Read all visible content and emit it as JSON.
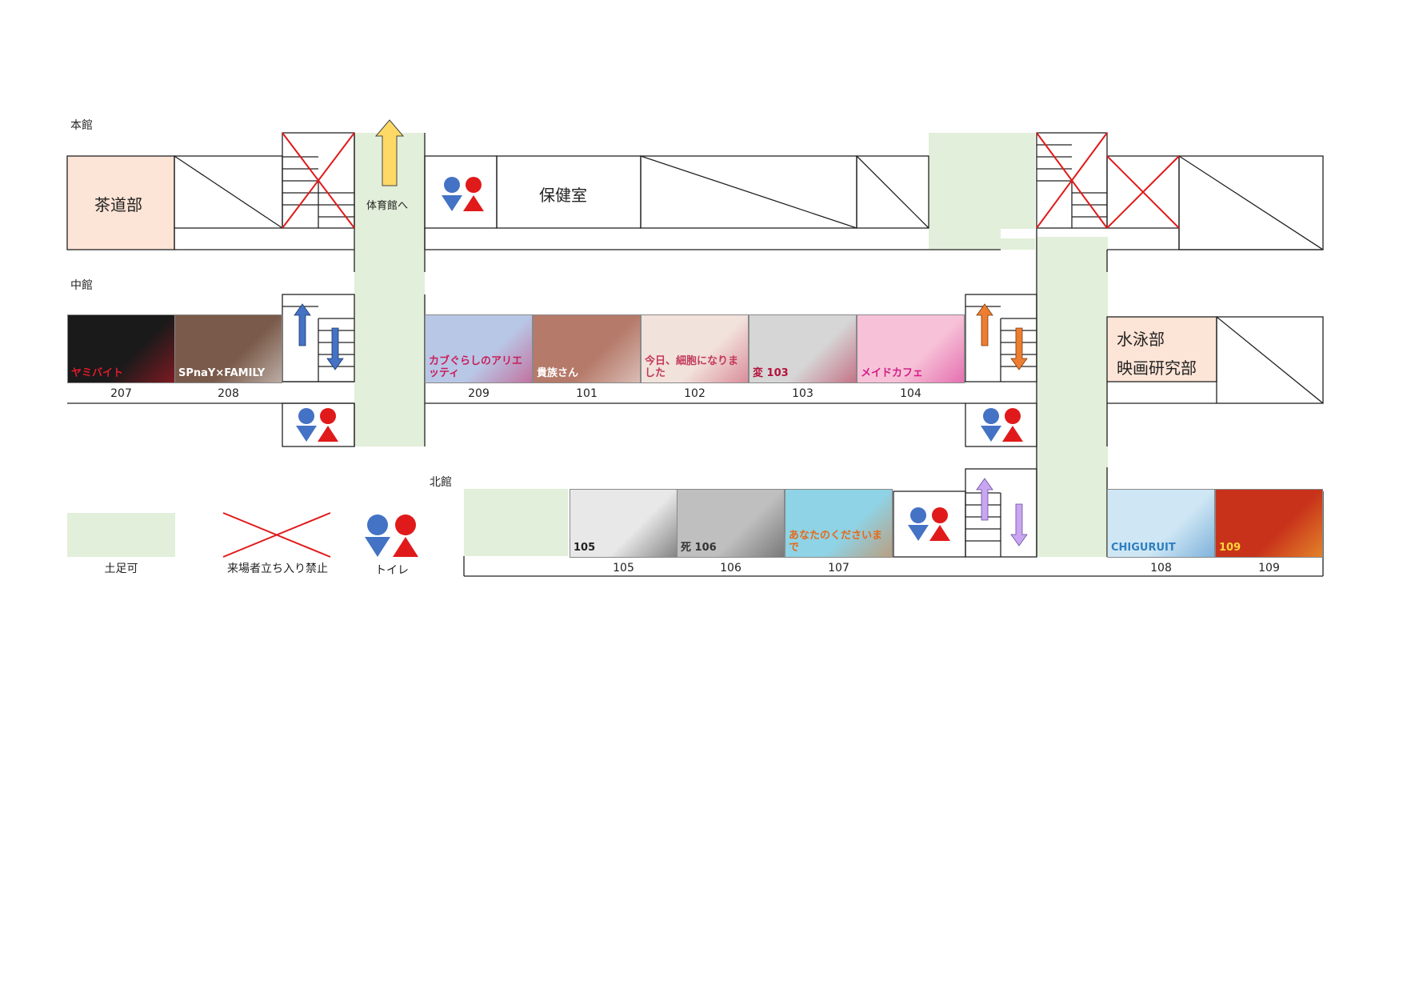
{
  "buildings": {
    "main": "本館",
    "middle": "中館",
    "north": "北館"
  },
  "rooms": {
    "tea_club": "茶道部",
    "infirmary": "保健室",
    "swim_club": "水泳部",
    "film_club": "映画研究部"
  },
  "to_gym": "体育館へ",
  "classrooms_middle": [
    {
      "num": "207",
      "caption": "ヤミバイト",
      "color": "#1a1a1a",
      "accent": "#e01a2a"
    },
    {
      "num": "208",
      "caption": "SPnaY×FAMILY",
      "color": "#7a5a4a",
      "accent": "#ffffff"
    },
    {
      "num": "209",
      "caption": "カブぐらしのアリエッティ",
      "color": "#b9c7e6",
      "accent": "#c81e5a"
    },
    {
      "num": "101",
      "caption": "貴族さん",
      "color": "#b57a6a",
      "accent": "#ffffff"
    },
    {
      "num": "102",
      "caption": "今日、細胞になりました",
      "color": "#f2e2dc",
      "accent": "#c23a5a"
    },
    {
      "num": "103",
      "caption": "変 103",
      "color": "#d6d6d6",
      "accent": "#b3123a"
    },
    {
      "num": "104",
      "caption": "メイドカフェ",
      "color": "#f7c2d8",
      "accent": "#d41e88"
    }
  ],
  "classrooms_north": [
    {
      "num": "105",
      "caption": "105",
      "color": "#e8e8e8",
      "accent": "#222222"
    },
    {
      "num": "106",
      "caption": "死 106",
      "color": "#bfbfbf",
      "accent": "#333333"
    },
    {
      "num": "107",
      "caption": "あなたのくださいまで",
      "color": "#8fd3e6",
      "accent": "#e46a1a"
    },
    {
      "num": "108",
      "caption": "CHIGURUIT",
      "color": "#cfe7f5",
      "accent": "#2f7fc0"
    },
    {
      "num": "109",
      "caption": "109",
      "color": "#c8321a",
      "accent": "#ffd43a"
    }
  ],
  "legend": {
    "shoes_ok": "土足可",
    "no_entry": "来場者立ち入り禁止",
    "toilet": "トイレ"
  },
  "colors": {
    "shoes_ok_fill": "#e2efda",
    "club_room_fill": "#fce4d6",
    "no_entry_line": "#e01a1a",
    "male_icon": "#4472c4",
    "female_icon": "#e01a1a",
    "arrow_yellow": "#ffd966",
    "arrow_blue": "#4472c4",
    "arrow_orange": "#ed7d31",
    "arrow_purple": "#c9a6f2"
  },
  "icons": [
    "toilet-icon",
    "arrow-up-icon",
    "arrow-down-icon",
    "no-entry-icon"
  ]
}
